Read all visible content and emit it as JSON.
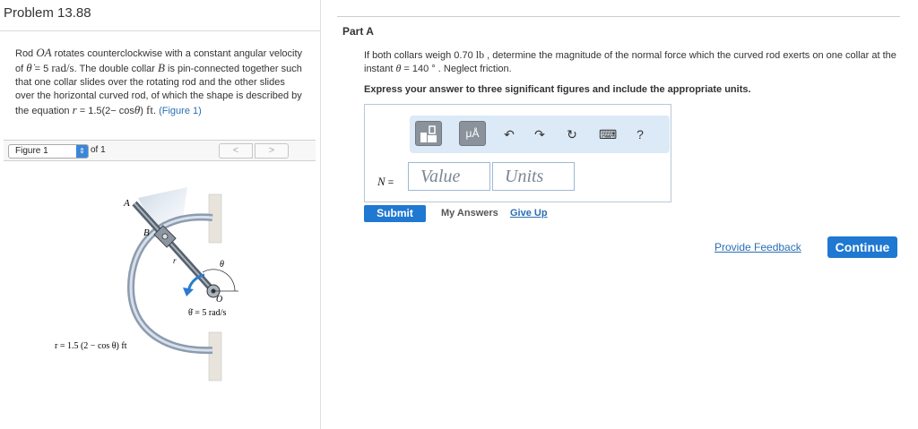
{
  "problem": {
    "title": "Problem 13.88",
    "text_parts": {
      "p1": "Rod ",
      "rod": "OA",
      "p2": " rotates counterclockwise with a constant angular velocity of ",
      "thetadot": "θ̇",
      "p3": " = 5 ",
      "unit_rad": "rad/s",
      "p4": ". The double collar ",
      "collar": "B",
      "p5": " is pin-connected together such that one collar slides over the rotating rod and the other slides over the horizontal curved rod, of which the shape is described by the equation ",
      "r": "r",
      "p6": " = 1.5(2− cos",
      "theta": "θ",
      "p7": ") ",
      "ft": "ft",
      "p8": ". ",
      "figure_link": "(Figure 1)"
    }
  },
  "figure": {
    "selector_value": "Figure 1",
    "of_label": "of 1",
    "prev_label": "<",
    "next_label": ">",
    "labels": {
      "A": "A",
      "B": "B",
      "r": "r",
      "theta": "θ",
      "O": "O",
      "omega": "θ̇ = 5 rad/s",
      "equation": "r = 1.5 (2 − cos θ) ft"
    }
  },
  "part": {
    "label": "Part A",
    "question_parts": {
      "q1": "If both collars weigh 0.70 ",
      "lb": "lb",
      "q2": " , determine the magnitude of the normal force which the curved rod exerts on one collar at the instant ",
      "theta": "θ",
      "q3": " = 140 ° . Neglect friction."
    },
    "instruction": "Express your answer to three significant figures and include the appropriate units.",
    "variable": "N",
    "equals": " =",
    "value_placeholder": "Value",
    "units_placeholder": "Units",
    "toolbar": {
      "units_button": "μÅ",
      "undo": "↶",
      "redo": "↷",
      "reset": "↻",
      "keyboard": "⌨",
      "help": "?"
    }
  },
  "actions": {
    "submit": "Submit",
    "my_answers": "My Answers",
    "give_up": "Give Up",
    "provide_feedback": "Provide Feedback",
    "continue": "Continue"
  },
  "colors": {
    "accent": "#1f78d1",
    "link": "#2a6fb4",
    "toolbar_bg": "#dce9f6"
  }
}
